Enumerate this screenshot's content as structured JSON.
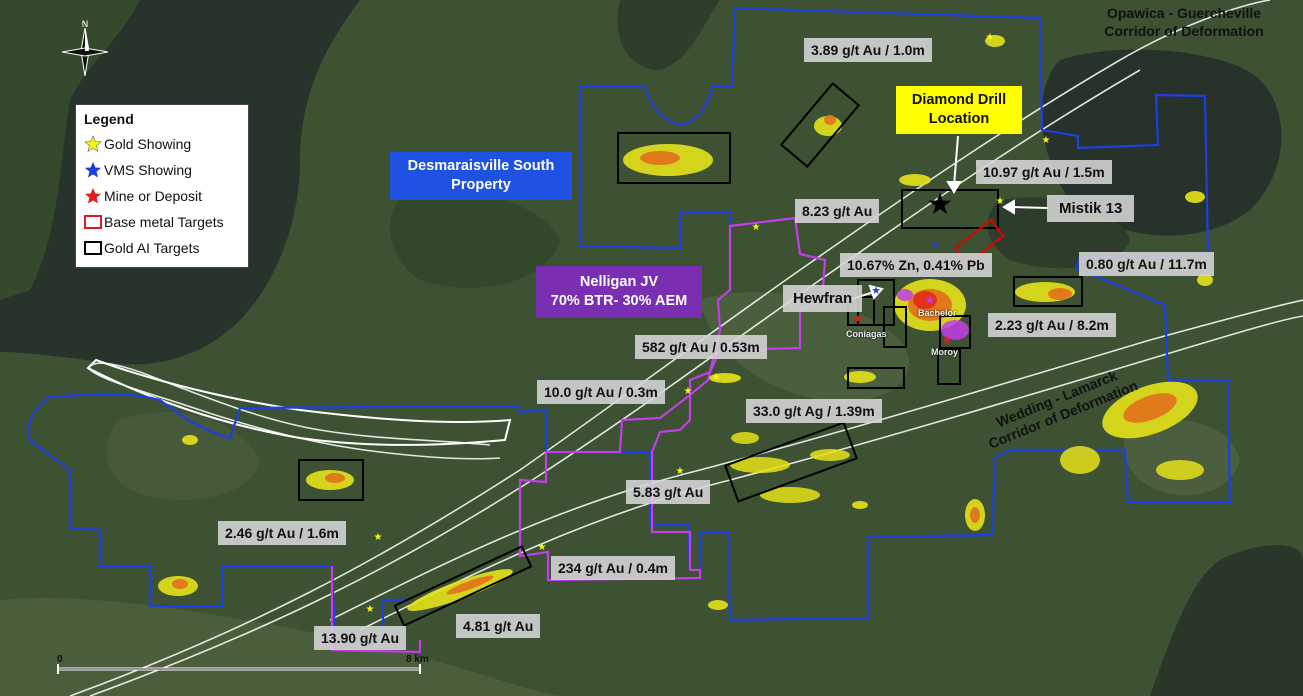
{
  "map": {
    "colors": {
      "land": "#3b5231",
      "water": "#26322a",
      "property_outline": "#1f3fe0",
      "jv_outline": "#c33de8",
      "corridor_line": "#ffffff",
      "gold_target_box": "#000000",
      "base_metal_box": "#e00000",
      "anomaly_yellow": "#e6e21a",
      "anomaly_orange": "#e07a1a"
    },
    "north_arrow": {
      "letter": "N",
      "icon": "north-arrow-icon"
    },
    "legend": {
      "title": "Legend",
      "items": [
        {
          "label": "Gold Showing",
          "icon": "yellow-star-icon",
          "color": "#f5f51a"
        },
        {
          "label": "VMS Showing",
          "icon": "blue-star-icon",
          "color": "#1c3fd9"
        },
        {
          "label": "Mine or Deposit",
          "icon": "red-star-icon",
          "color": "#e11b1b"
        },
        {
          "label": "Base metal Targets",
          "icon": "red-box-icon",
          "color": "#e11b1b"
        },
        {
          "label": "Gold AI Targets",
          "icon": "black-box-icon",
          "color": "#000000"
        }
      ]
    },
    "headings": {
      "desmaraisville": [
        "Desmaraisville South",
        "Property"
      ],
      "nelligan": [
        "Nelligan JV",
        "70% BTR- 30% AEM"
      ],
      "drill": [
        "Diamond Drill",
        "Location"
      ],
      "corridor_north": [
        "Opawica - Guercheville",
        "Corridor of Deformation"
      ],
      "corridor_south": [
        "Wedding - Lamarck",
        "Corridor of Deformation"
      ]
    },
    "assays": [
      "3.89 g/t Au / 1.0m",
      "10.97 g/t Au / 1.5m",
      "8.23 g/t Au",
      "Mistik 13",
      "10.67% Zn, 0.41% Pb",
      "0.80 g/t Au / 11.7m",
      "Hewfran",
      "2.23 g/t Au / 8.2m",
      "582 g/t Au / 0.53m",
      "10.0 g/t Au / 0.3m",
      "33.0 g/t Ag / 1.39m",
      "5.83 g/t Au",
      "2.46 g/t Au / 1.6m",
      "234 g/t Au / 0.4m",
      "13.90 g/t Au",
      "4.81 g/t Au"
    ],
    "towns": [
      "Bachelor",
      "Coniagas",
      "Moroy"
    ],
    "scale": {
      "start": "0",
      "end": "8 km"
    }
  }
}
